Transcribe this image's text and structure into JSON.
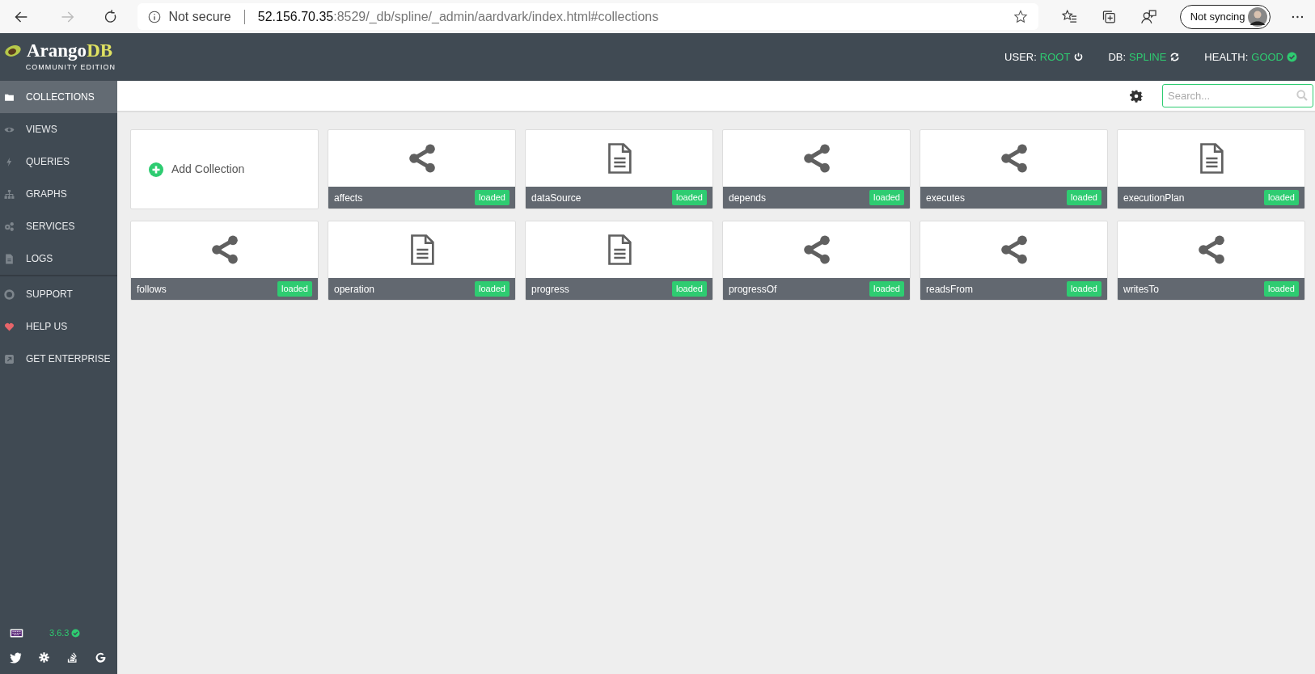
{
  "browser": {
    "security": "Not secure",
    "url_host": "52.156.70.35",
    "url_rest": ":8529/_db/spline/_admin/aardvark/index.html#collections",
    "profile": "Not syncing"
  },
  "logo": {
    "name_part_1": "Arango",
    "name_part_2": "DB",
    "edition": "COMMUNITY EDITION"
  },
  "status": [
    {
      "label": "USER:",
      "value": "ROOT",
      "kind": "power"
    },
    {
      "label": "DB:",
      "value": "SPLINE",
      "kind": "refresh"
    },
    {
      "label": "HEALTH:",
      "value": "GOOD",
      "kind": "check"
    }
  ],
  "sidebar": {
    "sections": [
      {
        "items": [
          {
            "label": "COLLECTIONS",
            "kind": "folder",
            "selected": true
          },
          {
            "label": "VIEWS",
            "kind": "eye",
            "selected": false
          },
          {
            "label": "QUERIES",
            "kind": "bolt",
            "selected": false
          },
          {
            "label": "GRAPHS",
            "kind": "sitemap",
            "selected": false
          },
          {
            "label": "SERVICES",
            "kind": "cogs",
            "selected": false
          },
          {
            "label": "LOGS",
            "kind": "file",
            "selected": false
          }
        ]
      },
      {
        "items": [
          {
            "label": "SUPPORT",
            "kind": "lifebuoy",
            "selected": false
          },
          {
            "label": "HELP US",
            "kind": "heart",
            "selected": false
          },
          {
            "label": "GET ENTERPRISE",
            "kind": "external",
            "selected": false
          }
        ]
      }
    ],
    "version": "3.6.3",
    "social": [
      {
        "kind": "twitter"
      },
      {
        "kind": "slack"
      },
      {
        "kind": "stackoverflow"
      },
      {
        "kind": "google"
      }
    ]
  },
  "search": {
    "placeholder": "Search..."
  },
  "add_collection": "Add Collection",
  "collections": [
    {
      "name": "affects",
      "kind": "edge",
      "status": "loaded"
    },
    {
      "name": "dataSource",
      "kind": "document",
      "status": "loaded"
    },
    {
      "name": "depends",
      "kind": "edge",
      "status": "loaded"
    },
    {
      "name": "executes",
      "kind": "edge",
      "status": "loaded"
    },
    {
      "name": "executionPlan",
      "kind": "document",
      "status": "loaded"
    },
    {
      "name": "follows",
      "kind": "edge",
      "status": "loaded"
    },
    {
      "name": "operation",
      "kind": "document",
      "status": "loaded"
    },
    {
      "name": "progress",
      "kind": "document",
      "status": "loaded"
    },
    {
      "name": "progressOf",
      "kind": "edge",
      "status": "loaded"
    },
    {
      "name": "readsFrom",
      "kind": "edge",
      "status": "loaded"
    },
    {
      "name": "writesTo",
      "kind": "edge",
      "status": "loaded"
    }
  ]
}
